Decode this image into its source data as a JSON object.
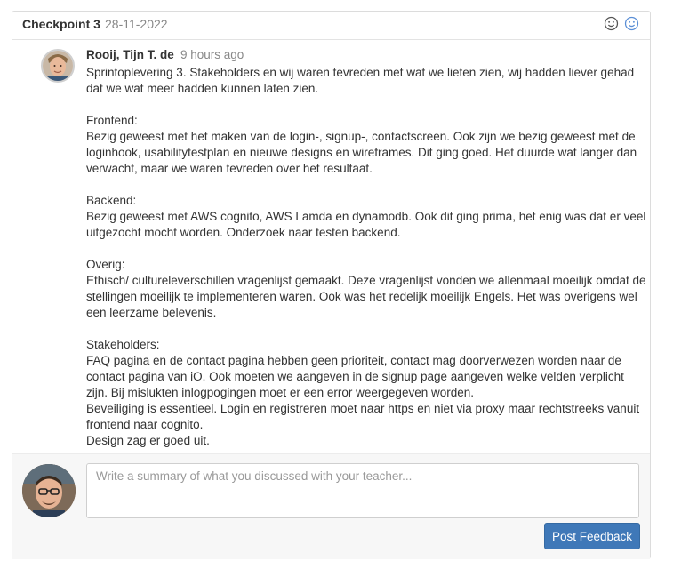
{
  "header": {
    "title": "Checkpoint 3",
    "date": "28-11-2022",
    "icons": [
      "smiley-neutral-icon",
      "smiley-active-icon"
    ]
  },
  "comment": {
    "author": "Rooij, Tijn T. de",
    "time": "9 hours ago",
    "body": "Sprintoplevering 3. Stakeholders en wij waren tevreden met wat we lieten zien, wij hadden liever gehad dat we wat meer hadden kunnen laten zien.\n\nFrontend:\nBezig geweest met het maken van de login-, signup-, contactscreen. Ook zijn we bezig geweest met de loginhook, usabilitytestplan en nieuwe designs en wireframes. Dit ging goed. Het duurde wat langer dan verwacht, maar we waren tevreden over het resultaat.\n\nBackend:\nBezig geweest met AWS cognito, AWS Lamda en dynamodb. Ook dit ging prima, het enig was dat er veel uitgezocht mocht worden. Onderzoek naar testen backend.\n\nOverig:\nEthisch/ cultureleverschillen vragenlijst gemaakt. Deze vragenlijst vonden we allenmaal moeilijk omdat de stellingen moeilijk te implementeren waren. Ook was het redelijk moeilijk Engels. Het was overigens wel een leerzame belevenis.\n\nStakeholders:\nFAQ pagina en de contact pagina hebben geen prioriteit, contact mag doorverwezen worden naar de contact pagina van iO. Ook moeten we aangeven in de signup page aangeven welke velden verplicht zijn. Bij mislukten inlogpogingen moet er een error weergegeven worden.\nBeveiliging is essentieel. Login en registreren moet naar https en niet via proxy maar rechtstreeks vanuit frontend naar cognito.\nDesign zag er goed uit."
  },
  "reply": {
    "placeholder": "Write a summary of what you discussed with your teacher...",
    "value": "",
    "button_label": "Post Feedback"
  },
  "colors": {
    "accent": "#3f78b8",
    "muted_text": "#888888",
    "active_icon": "#5b8fd6"
  }
}
